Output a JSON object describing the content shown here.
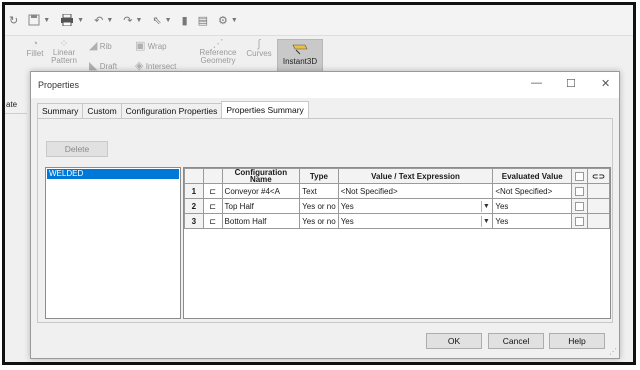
{
  "ribbon": {
    "fillet": "Fillet",
    "linear_pattern": "Linear Pattern",
    "rib": "Rib",
    "draft": "Draft",
    "wrap": "Wrap",
    "intersect": "Intersect",
    "reference_geometry": "Reference Geometry",
    "curves": "Curves",
    "instant3d": "Instant3D"
  },
  "left_strip_label": "ate",
  "dialog": {
    "title": "Properties",
    "tabs": [
      "Summary",
      "Custom",
      "Configuration Properties",
      "Properties Summary"
    ],
    "active_tab": "Properties Summary",
    "delete_label": "Delete",
    "configurations": [
      "WELDED"
    ],
    "columns": {
      "config_name": "Configuration Name",
      "type": "Type",
      "value_expression": "Value / Text Expression",
      "evaluated_value": "Evaluated Value"
    },
    "rows": [
      {
        "num": "1",
        "name": "Conveyor #4<A",
        "type": "Text",
        "value": "<Not Specified>",
        "evaluated": "<Not Specified>"
      },
      {
        "num": "2",
        "name": "Top Half",
        "type": "Yes or no",
        "value": "Yes",
        "evaluated": "Yes"
      },
      {
        "num": "3",
        "name": "Bottom Half",
        "type": "Yes or no",
        "value": "Yes",
        "evaluated": "Yes"
      }
    ],
    "ok_label": "OK",
    "cancel_label": "Cancel",
    "help_label": "Help"
  },
  "colors": {
    "selection": "#0078d7",
    "instant3d_bg": "#c9c9c9"
  }
}
